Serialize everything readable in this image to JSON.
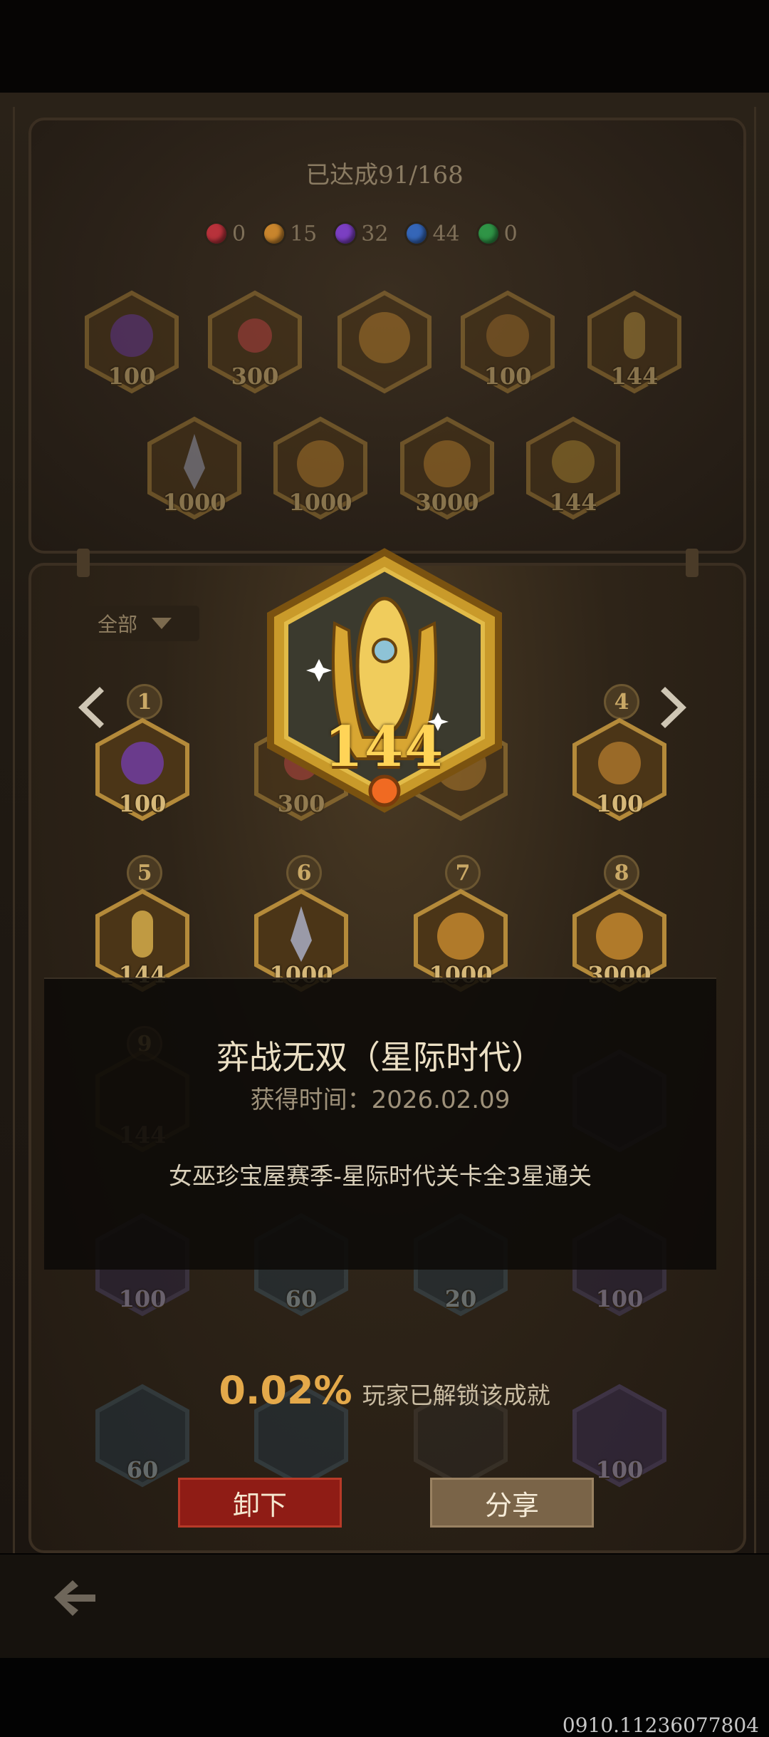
{
  "progress": {
    "text": "已达成91/168"
  },
  "rarity_counts": [
    {
      "icon": "red-gem-icon",
      "color": "#b8323b",
      "value": "0"
    },
    {
      "icon": "orange-gem-icon",
      "color": "#c8852d",
      "value": "15"
    },
    {
      "icon": "purple-gem-icon",
      "color": "#7b3fc2",
      "value": "32"
    },
    {
      "icon": "blue-gem-icon",
      "color": "#3566b8",
      "value": "44"
    },
    {
      "icon": "green-gem-icon",
      "color": "#2f9446",
      "value": "0"
    }
  ],
  "equipped_badges": [
    {
      "value": "100"
    },
    {
      "value": "300"
    },
    {
      "value": ""
    },
    {
      "value": "100"
    },
    {
      "value": "144"
    },
    {
      "value": "1000"
    },
    {
      "value": "1000"
    },
    {
      "value": "3000"
    },
    {
      "value": "144"
    }
  ],
  "filter": {
    "label": "全部"
  },
  "featured_badge": {
    "value": "144"
  },
  "grid": {
    "slots": [
      "1",
      "4",
      "5",
      "6",
      "7",
      "8",
      "9"
    ],
    "badges": [
      {
        "value": "100"
      },
      {
        "value": "300"
      },
      {
        "value": ""
      },
      {
        "value": "100"
      },
      {
        "value": "144"
      },
      {
        "value": "1000"
      },
      {
        "value": "1000"
      },
      {
        "value": "3000"
      },
      {
        "value": "144"
      },
      {
        "value": ""
      },
      {
        "value": "100"
      },
      {
        "value": "60"
      },
      {
        "value": "20"
      },
      {
        "value": "100"
      },
      {
        "value": "60"
      },
      {
        "value": ""
      },
      {
        "value": ""
      },
      {
        "value": "100"
      }
    ]
  },
  "detail": {
    "title": "弈战无双（星际时代）",
    "obtained_time": "获得时间：2026.02.09",
    "description": "女巫珍宝屋赛季-星际时代关卡全3星通关"
  },
  "unlock_stat": {
    "percent": "0.02%",
    "label": "玩家已解锁该成就"
  },
  "buttons": {
    "unequip": "卸下",
    "share": "分享"
  },
  "version": "0910.11236077804"
}
